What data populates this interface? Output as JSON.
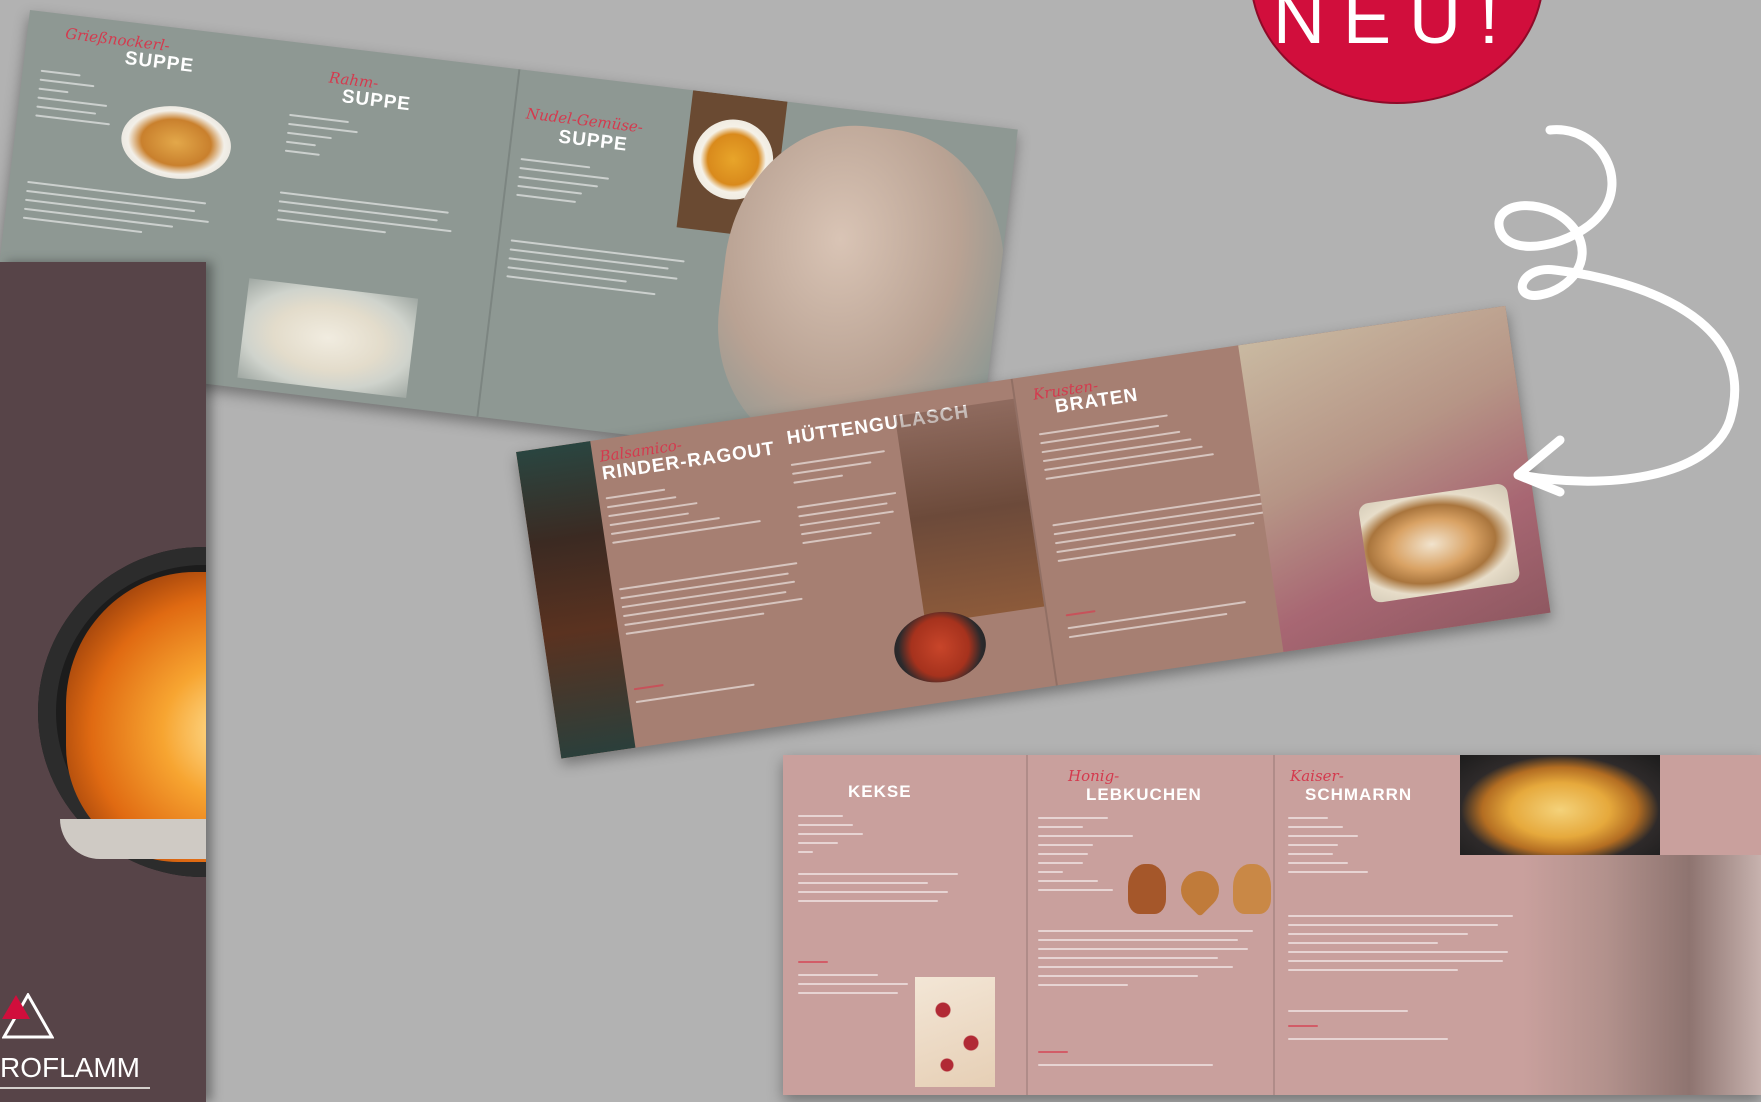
{
  "badge": {
    "text": "NEU!"
  },
  "cover": {
    "brand": "ROFLAMM"
  },
  "spread_soups": {
    "recipes": [
      {
        "script": "Grießnockerl-",
        "title": "SUPPE"
      },
      {
        "script": "Rahm-",
        "title": "SUPPE"
      },
      {
        "script": "Nudel-Gemüse-",
        "title": "SUPPE"
      }
    ]
  },
  "spread_mains": {
    "recipes": [
      {
        "script": "Balsamico-",
        "title": "RINDER-RAGOUT"
      },
      {
        "script": "",
        "title": "HÜTTENGULASCH"
      },
      {
        "script": "Krusten-",
        "title": "BRATEN"
      }
    ]
  },
  "spread_sweets": {
    "recipes": [
      {
        "script": "",
        "title": "KEKSE"
      },
      {
        "script": "Honig-",
        "title": "LEBKUCHEN"
      },
      {
        "script": "Kaiser-",
        "title": "SCHMARRN"
      }
    ]
  },
  "colors": {
    "background": "#b2b2b2",
    "badge": "#d10e3c",
    "cover": "#574448",
    "spread_soups": "#8e9893",
    "spread_mains": "#a67f72",
    "spread_sweets": "#c9a09d",
    "accent_script": "#d43a4e"
  },
  "icons": [
    "curly-arrow-icon",
    "roflamm-logo-icon"
  ]
}
